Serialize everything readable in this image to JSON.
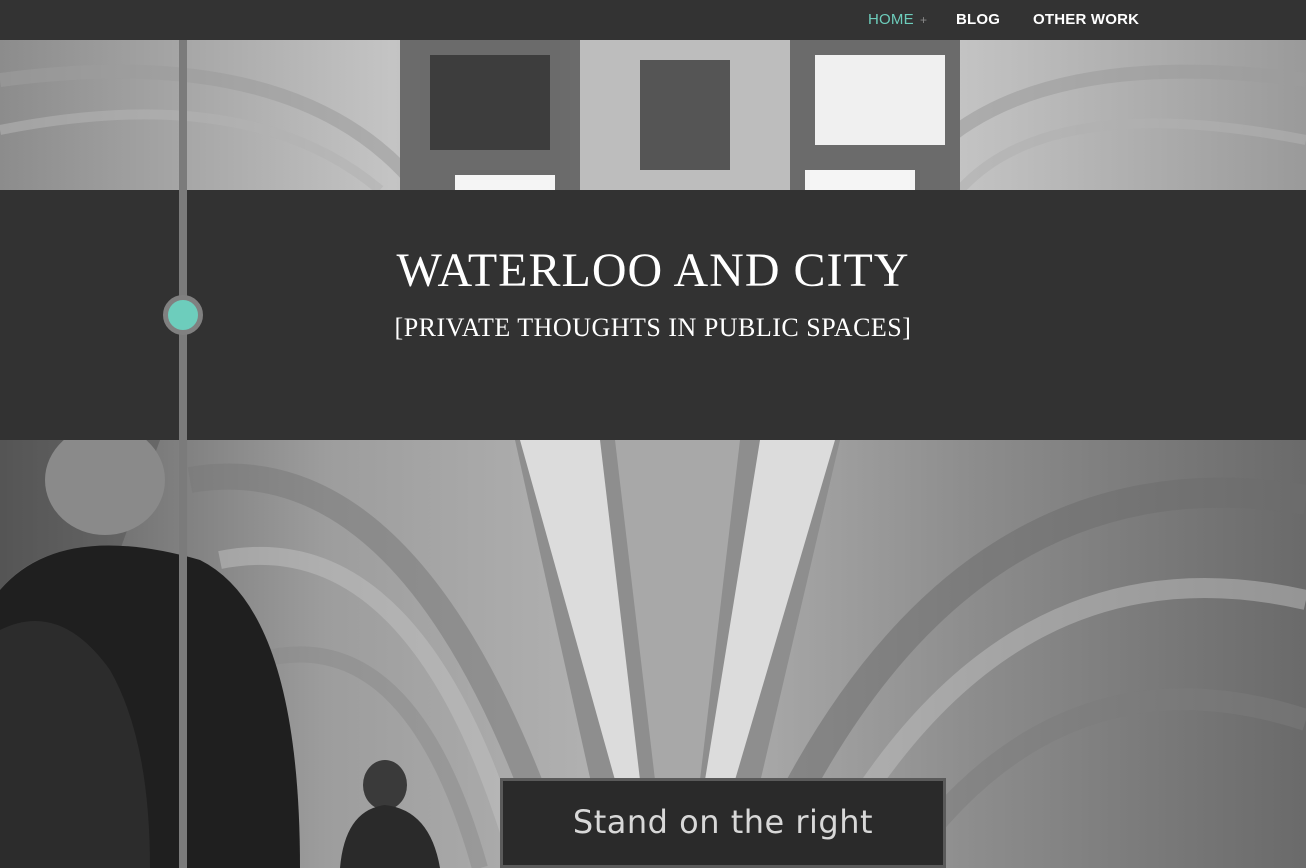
{
  "nav": {
    "items": [
      {
        "label": "HOME",
        "active": true
      },
      {
        "label": "BLOG",
        "active": false
      },
      {
        "label": "OTHER WORK",
        "active": false
      }
    ],
    "home_expand_glyph": "+"
  },
  "header": {
    "title": "WATERLOO AND CITY",
    "tagline": "[PRIVATE THOUGHTS IN PUBLIC SPACES]"
  },
  "photo": {
    "sign_text": "Stand on the right"
  },
  "colors": {
    "accent": "#6dcdbc",
    "nav_bg": "#333333",
    "header_bg": "#323232",
    "timeline": "#7b7b7b"
  }
}
